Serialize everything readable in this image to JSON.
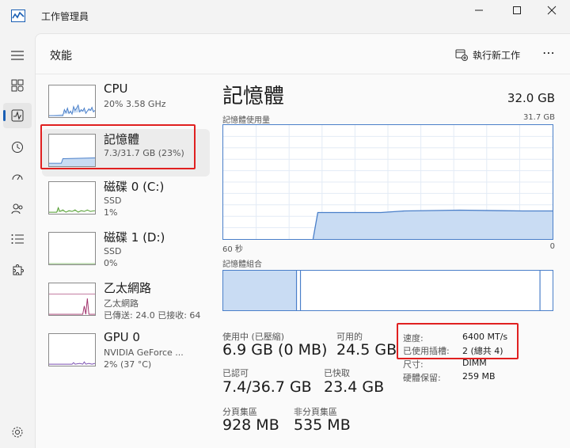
{
  "window": {
    "title": "工作管理員"
  },
  "page": {
    "title": "效能",
    "run_task_label": "執行新工作"
  },
  "sidebar": {
    "items": [
      {
        "title": "CPU",
        "sub1": "20%  3.58 GHz",
        "sub2": "",
        "sub3": ""
      },
      {
        "title": "記憶體",
        "sub1": "7.3/31.7 GB (23%)",
        "sub2": "",
        "sub3": ""
      },
      {
        "title": "磁碟 0 (C:)",
        "sub1": "SSD",
        "sub2": "1%",
        "sub3": ""
      },
      {
        "title": "磁碟 1 (D:)",
        "sub1": "SSD",
        "sub2": "0%",
        "sub3": ""
      },
      {
        "title": "乙太網路",
        "sub1": "乙太網路",
        "sub2": "已傳送: 24.0  已接收: 64",
        "sub3": ""
      },
      {
        "title": "GPU 0",
        "sub1": "NVIDIA GeForce ...",
        "sub2": "2% (37 °C)",
        "sub3": ""
      }
    ]
  },
  "memory": {
    "title": "記憶體",
    "total": "32.0 GB",
    "usage_label": "記憶體使用量",
    "usage_max": "31.7 GB",
    "axis_left": "60 秒",
    "axis_right": "0",
    "composition_label": "記憶體組合",
    "usage_fraction": 0.23,
    "stats": {
      "in_use_label": "使用中 (已壓縮)",
      "in_use_value": "6.9 GB (0 MB)",
      "available_label": "可用的",
      "available_value": "24.5 GB",
      "committed_label": "已認可",
      "committed_value": "7.4/36.7 GB",
      "cached_label": "已快取",
      "cached_value": "23.4 GB",
      "paged_label": "分頁集區",
      "paged_value": "928 MB",
      "nonpaged_label": "非分頁集區",
      "nonpaged_value": "535 MB"
    },
    "specs": {
      "speed_label": "速度:",
      "speed_value": "6400 MT/s",
      "slots_label": "已使用插槽:",
      "slots_value": "2 (總共 4)",
      "form_label": "尺寸:",
      "form_value": "DIMM",
      "reserved_label": "硬體保留:",
      "reserved_value": "259 MB"
    }
  },
  "colors": {
    "accent": "#1a5fb4",
    "graph_line": "#4a7fc9",
    "graph_fill": "#c9dcf3",
    "highlight": "#e02020",
    "disk_line": "#4c9a2a",
    "net_line": "#a0306a",
    "gpu_line": "#7a4fb0"
  }
}
